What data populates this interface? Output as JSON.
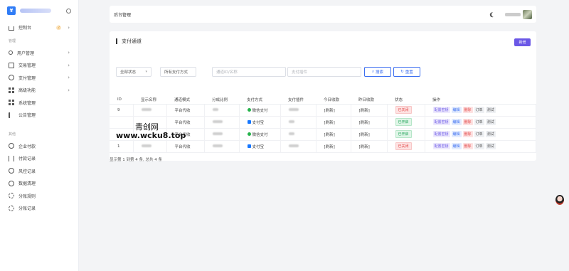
{
  "sidebar": {
    "logo_char": "¥",
    "top_item": {
      "label": "控制台",
      "badge": "2"
    },
    "section1": "管理",
    "items1": [
      "用户管理",
      "交易管理",
      "支付管理",
      "高级功能",
      "系统管理",
      "公告管理"
    ],
    "section2": "其他",
    "items2": [
      "企业付款",
      "付款记录",
      "风控记录",
      "数据清理",
      "分账规则",
      "分账记录"
    ]
  },
  "topbar": {
    "title": "后台管理"
  },
  "card": {
    "title": "支付通道",
    "add_label": "新增"
  },
  "filters": {
    "status": "全部状态",
    "method": "所有支付方式",
    "id_placeholder": "通道ID/名称",
    "plugin_placeholder": "支付插件",
    "search_label": "搜索",
    "reset_label": "重置"
  },
  "table": {
    "headers": [
      "ID",
      "显示名称",
      "通道模式",
      "分成比例",
      "支付方式",
      "支付插件",
      "今日收款",
      "昨日收款",
      "状态",
      "操作"
    ],
    "rows": [
      {
        "id": "9",
        "mode": "平台代收",
        "method": "微信支付",
        "method_type": "wx",
        "today": "[刷新]",
        "yesterday": "[刷新]",
        "status": "已关闭",
        "status_type": "off"
      },
      {
        "id": "",
        "mode": "平台代收",
        "method": "支付宝",
        "method_type": "ali",
        "today": "[刷新]",
        "yesterday": "[刷新]",
        "status": "已开启",
        "status_type": "on"
      },
      {
        "id": "",
        "mode": "平台代收",
        "method": "微信支付",
        "method_type": "wx",
        "today": "[刷新]",
        "yesterday": "[刷新]",
        "status": "已开启",
        "status_type": "on"
      },
      {
        "id": "1",
        "mode": "平台代收",
        "method": "支付宝",
        "method_type": "ali",
        "today": "[刷新]",
        "yesterday": "[刷新]",
        "status": "已关闭",
        "status_type": "off"
      }
    ],
    "ops": [
      "配置密钥",
      "编辑",
      "删除",
      "订单",
      "测试"
    ]
  },
  "pager": "显示第 1 到第 4 条, 总共 4 条",
  "watermark": {
    "line1": "青创网",
    "line2": "www.wcku8.top"
  }
}
